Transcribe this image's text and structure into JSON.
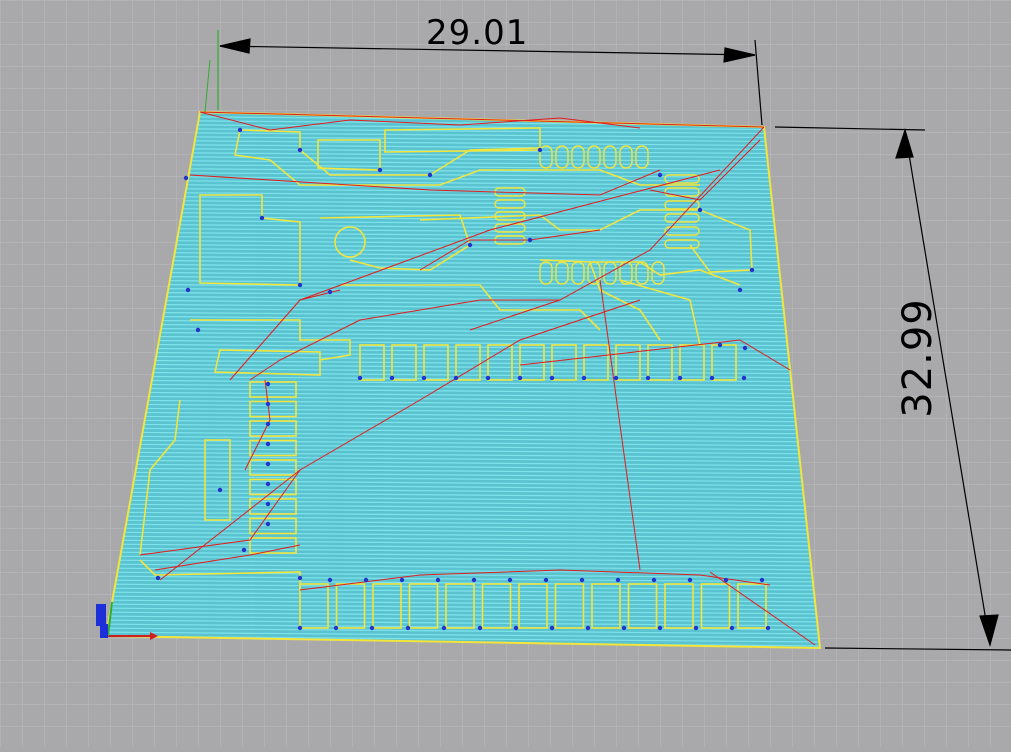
{
  "viewport": {
    "background": "#a9a9ab",
    "grid_color": "#bdbdbf",
    "grid_major_color": "#8f8f92"
  },
  "board": {
    "fill": "#5bc3d0",
    "hatch_color": "#7fe3ec",
    "outline_color": "#f2e53c",
    "travel_color": "#e41c1c",
    "pad_color": "#f2e53c",
    "via_color": "#2233cc"
  },
  "dimensions": {
    "width_value": "29.01",
    "height_value": "32.99"
  },
  "axes": {
    "x_color": "#d01f1f",
    "y_color": "#2fae2f",
    "z_color": "#1c2fd9"
  }
}
